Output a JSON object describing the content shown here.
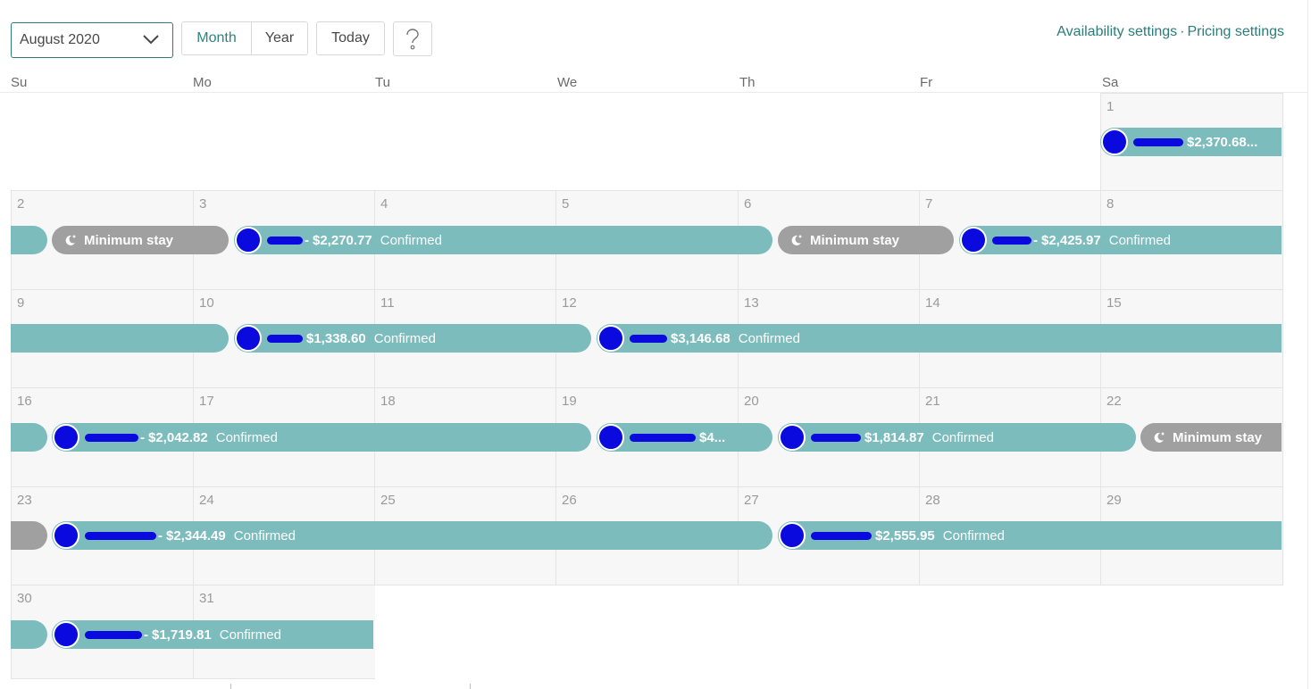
{
  "toolbar": {
    "month_select": "August 2020",
    "view_month": "Month",
    "view_year": "Year",
    "today": "Today",
    "help_icon": "question-mark-icon",
    "availability_settings": "Availability settings",
    "separator": "·",
    "pricing_settings": "Pricing settings"
  },
  "colors": {
    "accent": "#2b7c7a",
    "reservation_bar": "#7cbcbd",
    "blocked_bar": "#a0a0a0",
    "cell_background": "#f7f7f7"
  },
  "calendar": {
    "weekdays": [
      "Su",
      "Mo",
      "Tu",
      "We",
      "Th",
      "Fr",
      "Sa"
    ],
    "days": [
      "1",
      "2",
      "3",
      "4",
      "5",
      "6",
      "7",
      "8",
      "9",
      "10",
      "11",
      "12",
      "13",
      "14",
      "15",
      "16",
      "17",
      "18",
      "19",
      "20",
      "21",
      "22",
      "23",
      "24",
      "25",
      "26",
      "27",
      "28",
      "29",
      "30",
      "31"
    ],
    "events": [
      {
        "type": "reservation",
        "price": "$2,370.68...",
        "status": "",
        "dash": ""
      },
      {
        "type": "reservation",
        "price": "",
        "status": "",
        "dash": ""
      },
      {
        "type": "minimum_stay",
        "label": "Minimum stay"
      },
      {
        "type": "reservation",
        "price": "$2,270.77",
        "status": "Confirmed",
        "dash": "-"
      },
      {
        "type": "minimum_stay",
        "label": "Minimum stay"
      },
      {
        "type": "reservation",
        "price": "$2,425.97",
        "status": "Confirmed",
        "dash": "-"
      },
      {
        "type": "reservation",
        "price": "",
        "status": "",
        "dash": ""
      },
      {
        "type": "reservation",
        "price": "$1,338.60",
        "status": "Confirmed",
        "dash": ""
      },
      {
        "type": "reservation",
        "price": "$3,146.68",
        "status": "Confirmed",
        "dash": ""
      },
      {
        "type": "reservation",
        "price": "",
        "status": "",
        "dash": ""
      },
      {
        "type": "reservation",
        "price": "$2,042.82",
        "status": "Confirmed",
        "dash": "-"
      },
      {
        "type": "reservation",
        "price": "$4...",
        "status": "",
        "dash": ""
      },
      {
        "type": "reservation",
        "price": "$1,814.87",
        "status": "Confirmed",
        "dash": ""
      },
      {
        "type": "minimum_stay",
        "label": "Minimum stay"
      },
      {
        "type": "minimum_stay",
        "label": ""
      },
      {
        "type": "reservation",
        "price": "$2,344.49",
        "status": "Confirmed",
        "dash": "-"
      },
      {
        "type": "reservation",
        "price": "",
        "status": "",
        "dash": ""
      },
      {
        "type": "reservation",
        "price": "$2,555.95",
        "status": "Confirmed",
        "dash": ""
      },
      {
        "type": "reservation",
        "price": "",
        "status": "",
        "dash": ""
      },
      {
        "type": "reservation",
        "price": "$1,719.81",
        "status": "Confirmed",
        "dash": "-"
      }
    ]
  }
}
